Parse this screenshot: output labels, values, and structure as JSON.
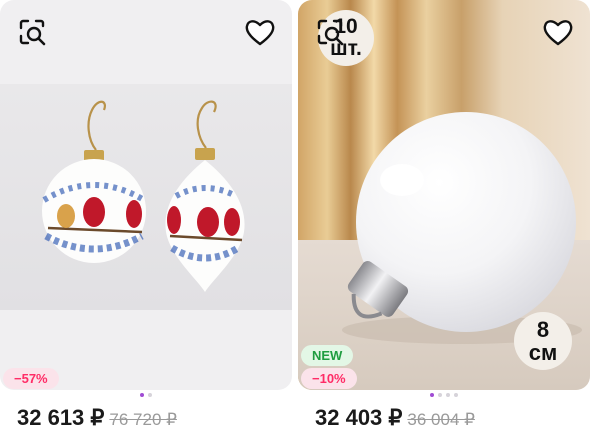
{
  "cards": [
    {
      "discount_badge": "−57%",
      "price": "32 613 ₽",
      "old_price": "76 720 ₽",
      "dots_count": 2,
      "active_dot": 0
    },
    {
      "quantity_badge": {
        "value": "10",
        "unit": "шт."
      },
      "size_badge": {
        "value": "8",
        "unit": "см"
      },
      "new_badge": "NEW",
      "discount_badge": "−10%",
      "price": "32 403 ₽",
      "old_price": "36 004 ₽",
      "dots_count": 4,
      "active_dot": 0
    }
  ],
  "icons": {
    "search": "search-photo-icon",
    "favorite": "heart-icon"
  },
  "colors": {
    "discount": "#ff2c66",
    "new": "#1f9d40",
    "active_dot": "#a04cd4"
  }
}
